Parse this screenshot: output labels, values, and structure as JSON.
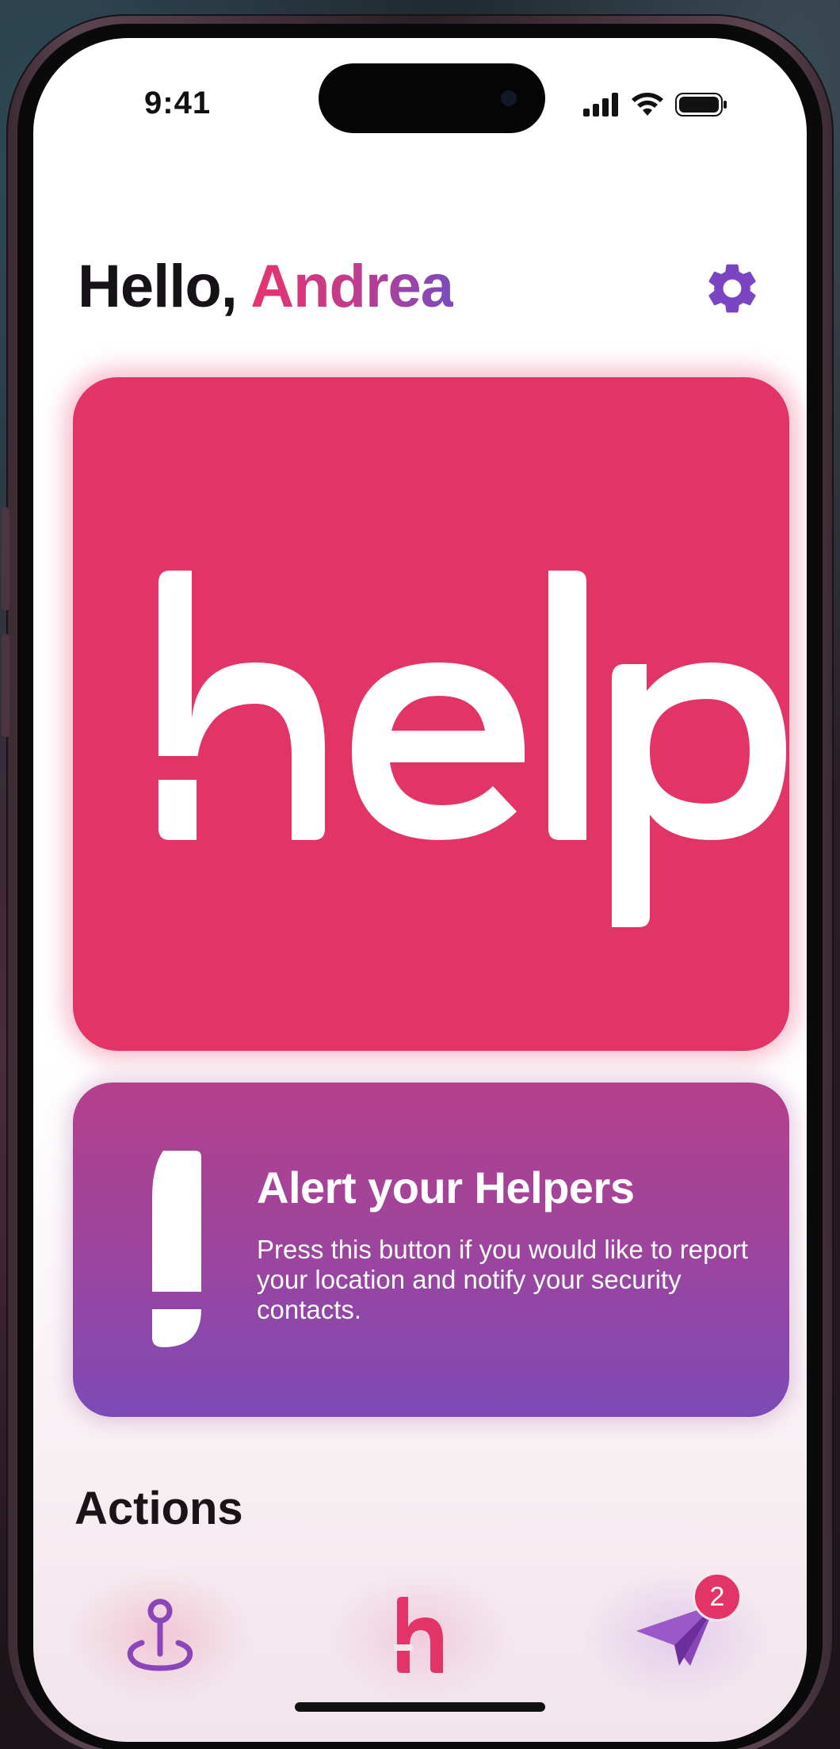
{
  "status_bar": {
    "time": "9:41",
    "signal_icon": "signal-icon",
    "wifi_icon": "wifi-icon",
    "battery_icon": "battery-icon"
  },
  "header": {
    "greeting_prefix": "Hello,",
    "user_name": "Andrea",
    "settings_icon": "gear-icon"
  },
  "help_button": {
    "label": "help"
  },
  "alert_card": {
    "title": "Alert your Helpers",
    "description": "Press this button if you would like to report your location and notify your security contacts.",
    "icon": "exclamation-icon"
  },
  "actions": {
    "title": "Actions"
  },
  "tab_bar": {
    "items": [
      {
        "name": "map",
        "icon": "location-pin-icon"
      },
      {
        "name": "help",
        "icon": "help-logo-icon"
      },
      {
        "name": "messages",
        "icon": "paper-plane-icon",
        "badge": "2"
      }
    ]
  },
  "colors": {
    "brand_pink": "#e23466",
    "brand_purple": "#7c4ab7",
    "text_dark": "#161218"
  }
}
